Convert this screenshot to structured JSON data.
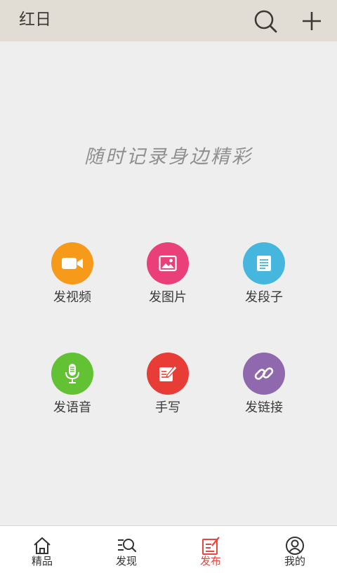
{
  "header": {
    "title": "红日",
    "search_icon": "search-icon",
    "add_icon": "plus-icon"
  },
  "slogan": "随时记录身边精彩",
  "actions": [
    {
      "label": "发视频",
      "icon": "video-camera-icon",
      "color": "#f79a1a"
    },
    {
      "label": "发图片",
      "icon": "image-icon",
      "color": "#e9407a"
    },
    {
      "label": "发段子",
      "icon": "document-icon",
      "color": "#45b6de"
    },
    {
      "label": "发语音",
      "icon": "microphone-icon",
      "color": "#62c234"
    },
    {
      "label": "手写",
      "icon": "edit-icon",
      "color": "#e83c36"
    },
    {
      "label": "发链接",
      "icon": "link-icon",
      "color": "#8f68ad"
    }
  ],
  "tabbar": {
    "active_color": "#e8463f",
    "tabs": [
      {
        "label": "精品",
        "icon": "home-icon"
      },
      {
        "label": "发现",
        "icon": "discover-search-icon"
      },
      {
        "label": "发布",
        "icon": "publish-icon",
        "active": true
      },
      {
        "label": "我的",
        "icon": "profile-icon"
      }
    ]
  }
}
